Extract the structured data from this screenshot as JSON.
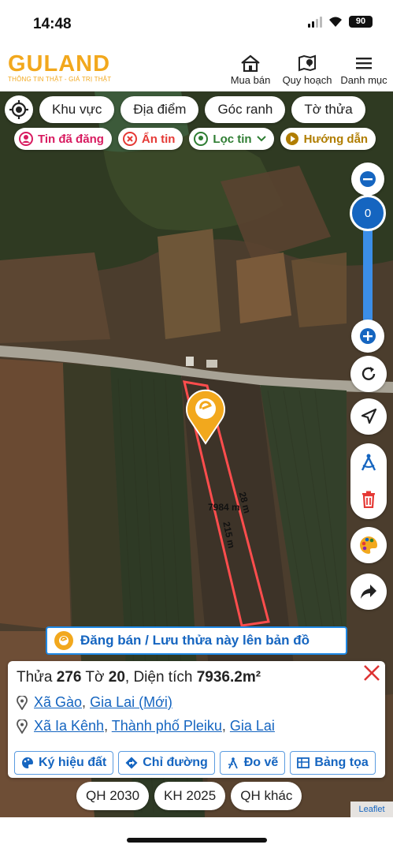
{
  "status_bar": {
    "time": "14:48",
    "battery": "90"
  },
  "header": {
    "logo_main": "GULAND",
    "logo_sub": "THÔNG TIN THẬT - GIÁ TRỊ THẬT",
    "nav": [
      {
        "label": "Mua bán",
        "icon": "house-icon"
      },
      {
        "label": "Quy hoạch",
        "icon": "map-pin-icon"
      },
      {
        "label": "Danh mục",
        "icon": "menu-icon"
      }
    ]
  },
  "filters": {
    "chips": [
      "Khu vực",
      "Địa điểm",
      "Góc ranh",
      "Tờ thửa"
    ],
    "pills": [
      {
        "label": "Tin đã đăng",
        "color": "#d81b60"
      },
      {
        "label": "Ẩn tin",
        "color": "#e53935"
      },
      {
        "label": "Lọc tin",
        "color": "#2e7d32"
      },
      {
        "label": "Hướng dẫn",
        "color": "#b07d00"
      }
    ]
  },
  "map": {
    "zoom_value": "0",
    "parcel_color": "#ff4d4d",
    "edge_labels": [
      "7984 m",
      "28 m",
      "215 m"
    ]
  },
  "banner": {
    "text": "Đăng bán / Lưu thửa này lên bản đồ"
  },
  "parcel": {
    "thua_label": "Thửa",
    "thua_value": "276",
    "to_label": "Tờ",
    "to_value": "20",
    "area_label": ", Diện tích",
    "area_value": "7936.2m²",
    "new_address": {
      "commune": "Xã Gào",
      "province": "Gia Lai (Mới)"
    },
    "old_address": {
      "commune": "Xã Ia Kênh",
      "city": "Thành phố Pleiku",
      "province": "Gia Lai"
    },
    "actions": [
      "Ký hiệu đất",
      "Chỉ đường",
      "Đo vẽ",
      "Bảng tọa"
    ]
  },
  "plans": [
    "QH 2030",
    "KH 2025",
    "QH khác"
  ],
  "attribution": "Leaflet",
  "colors": {
    "accent": "#1565c0",
    "brand": "#f2a81d"
  }
}
